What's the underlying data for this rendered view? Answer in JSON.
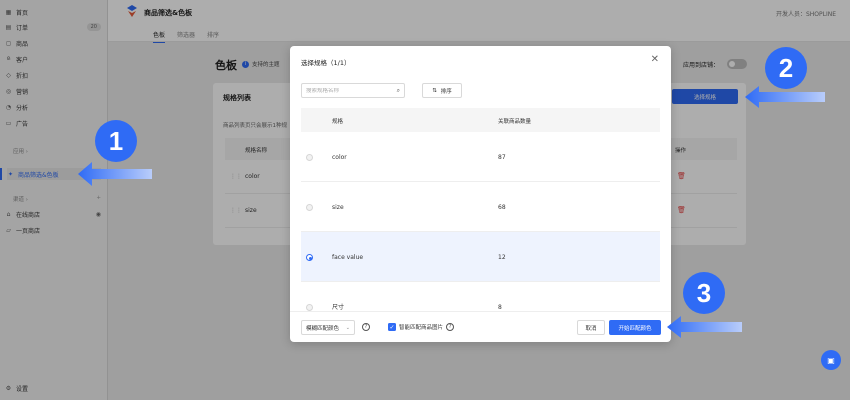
{
  "sidebar": {
    "items": [
      {
        "label": "首页",
        "icon": "grid-icon"
      },
      {
        "label": "订单",
        "icon": "order-icon",
        "count": "20"
      },
      {
        "label": "商品",
        "icon": "bag-icon"
      },
      {
        "label": "客户",
        "icon": "user-icon"
      },
      {
        "label": "折扣",
        "icon": "tag-icon"
      },
      {
        "label": "营销",
        "icon": "target-icon"
      },
      {
        "label": "分析",
        "icon": "chart-icon"
      },
      {
        "label": "广告",
        "icon": "ad-icon"
      }
    ],
    "apps_section": "应用",
    "active_app": "商品筛选&色板",
    "channels_section": "渠道",
    "channels": [
      {
        "label": "在线商店",
        "icon": "store-icon"
      },
      {
        "label": "一页商店",
        "icon": "page-icon"
      }
    ],
    "settings": "设置"
  },
  "header": {
    "app_title": "商品筛选&色板",
    "developer": "开发人员：SHOPLINE",
    "tabs": [
      "色板",
      "筛选器",
      "排序"
    ]
  },
  "main": {
    "title": "色板",
    "theme_info": "支持的主题",
    "apply_label": "应用到店铺：",
    "card_title": "规格列表",
    "card_desc": "商品列表页只会展示1种规",
    "select_spec_button": "选择规格",
    "table_headers": {
      "name": "规格名称",
      "action": "操作"
    },
    "rows": [
      {
        "name": "color"
      },
      {
        "name": "size"
      }
    ]
  },
  "modal": {
    "title": "选择规格（1/1）",
    "search_placeholder": "搜索规格名称",
    "sort_label": "排序",
    "headers": {
      "spec": "规格",
      "count": "关联商品数量"
    },
    "rows": [
      {
        "spec": "color",
        "count": "87",
        "selected": false
      },
      {
        "spec": "size",
        "count": "68",
        "selected": false
      },
      {
        "spec": "face value",
        "count": "12",
        "selected": true
      },
      {
        "spec": "尺寸",
        "count": "8",
        "selected": false
      }
    ],
    "fuzzy_match": "模糊匹配颜色",
    "smart_match": "智能匹配商品图片",
    "cancel": "取消",
    "start": "开始匹配颜色"
  },
  "annotations": [
    "1",
    "2",
    "3"
  ],
  "colors": {
    "accent": "#2f6bf5",
    "danger": "#e64545"
  }
}
